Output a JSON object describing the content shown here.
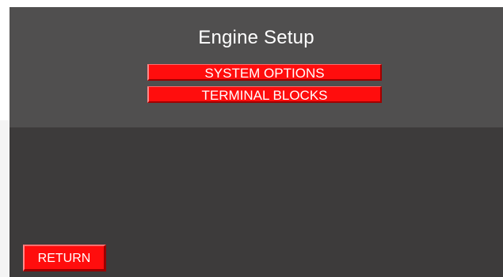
{
  "screen": {
    "title": "Engine Setup"
  },
  "menu": {
    "items": [
      {
        "label": "SYSTEM OPTIONS"
      },
      {
        "label": "TERMINAL BLOCKS"
      }
    ]
  },
  "footer": {
    "return_label": "RETURN"
  },
  "colors": {
    "button": "#ff0d0d",
    "panel_top": "#504f4f",
    "panel_bottom": "#3d3b3b",
    "text": "#ffffff"
  }
}
